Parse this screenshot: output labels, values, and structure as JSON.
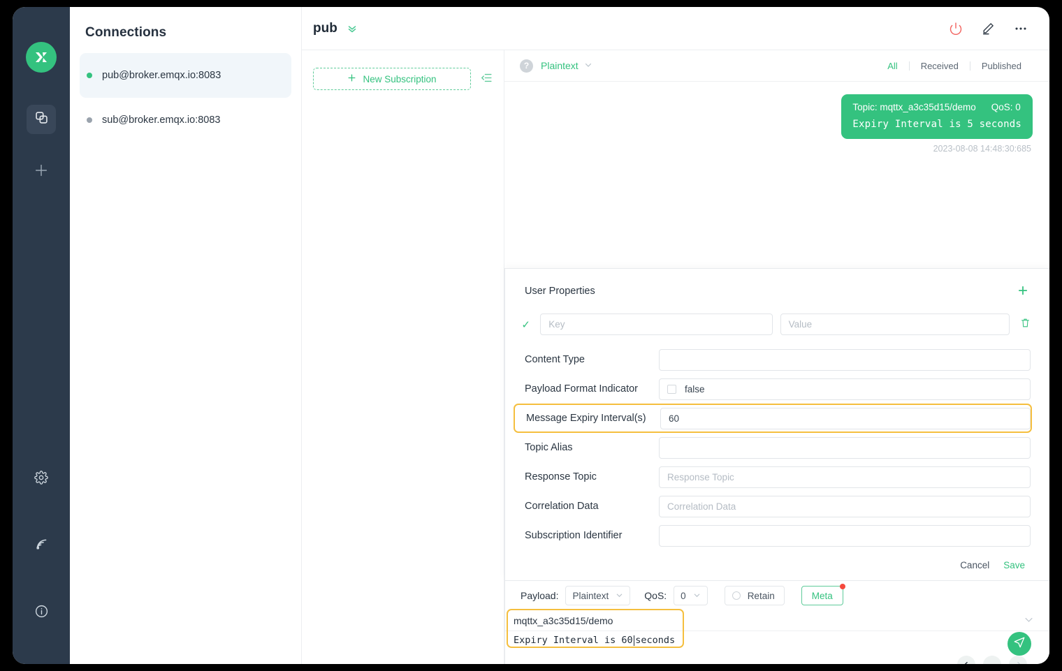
{
  "sidebar_rail": {
    "logo_icon": "mqttx-logo-icon",
    "items": [
      {
        "icon": "connections-icon",
        "name": "connections",
        "active": true
      },
      {
        "icon": "plus-icon",
        "name": "new-connection",
        "active": false
      }
    ],
    "bottom_items": [
      {
        "icon": "gear-icon",
        "name": "settings"
      },
      {
        "icon": "broadcast-icon",
        "name": "logs"
      },
      {
        "icon": "info-icon",
        "name": "about"
      }
    ]
  },
  "connections": {
    "title": "Connections",
    "items": [
      {
        "label": "pub@broker.emqx.io:8083",
        "status": "online",
        "selected": true
      },
      {
        "label": "sub@broker.emqx.io:8083",
        "status": "offline",
        "selected": false
      }
    ]
  },
  "topbar": {
    "tab_title": "pub",
    "chevron_icon": "double-chevron-down-icon",
    "actions": [
      {
        "icon": "power-icon",
        "name": "disconnect"
      },
      {
        "icon": "edit-icon",
        "name": "edit-connection"
      },
      {
        "icon": "more-icon",
        "name": "more-options"
      }
    ]
  },
  "subscriptions": {
    "new_subscription_label": "New Subscription",
    "plus_icon": "plus-icon",
    "collapse_icon": "collapse-list-icon"
  },
  "messages_toolbar": {
    "help_icon": "help-circle-icon",
    "format_value": "Plaintext",
    "format_chevron": "chevron-down-icon",
    "filters": [
      {
        "label": "All",
        "active": true
      },
      {
        "label": "Received",
        "active": false
      },
      {
        "label": "Published",
        "active": false
      }
    ]
  },
  "messages": [
    {
      "topic_label": "Topic: mqttx_a3c35d15/demo",
      "qos_label": "QoS: 0",
      "payload": "Expiry Interval is 5 seconds",
      "time": "2023-08-08 14:48:30:685",
      "direction": "published"
    }
  ],
  "meta_panel": {
    "title": "User Properties",
    "add_icon": "plus-icon",
    "user_property_row": {
      "check_icon": "check-icon",
      "key_placeholder": "Key",
      "key_value": "",
      "value_placeholder": "Value",
      "value_value": "",
      "delete_icon": "trash-icon"
    },
    "fields": [
      {
        "label": "Content Type",
        "value": "",
        "placeholder": "",
        "type": "text",
        "highlight": false
      },
      {
        "label": "Payload Format Indicator",
        "value": "false",
        "placeholder": "",
        "type": "checkbox",
        "highlight": false
      },
      {
        "label": "Message Expiry Interval(s)",
        "value": "60",
        "placeholder": "",
        "type": "text",
        "highlight": true
      },
      {
        "label": "Topic Alias",
        "value": "",
        "placeholder": "",
        "type": "text",
        "highlight": false
      },
      {
        "label": "Response Topic",
        "value": "",
        "placeholder": "Response Topic",
        "type": "text",
        "highlight": false
      },
      {
        "label": "Correlation Data",
        "value": "",
        "placeholder": "Correlation Data",
        "type": "text",
        "highlight": false
      },
      {
        "label": "Subscription Identifier",
        "value": "",
        "placeholder": "",
        "type": "text",
        "highlight": false
      }
    ],
    "cancel_label": "Cancel",
    "save_label": "Save"
  },
  "publish_bar": {
    "payload_label": "Payload:",
    "payload_value": "Plaintext",
    "qos_label": "QoS:",
    "qos_value": "0",
    "retain_label": "Retain",
    "retain_checked": false,
    "meta_label": "Meta",
    "meta_has_badge": true,
    "topic_value": "mqttx_a3c35d15/demo",
    "message_before_caret": "Expiry Interval is 60",
    "message_after_caret": " seconds",
    "expand_icon": "chevron-down-icon",
    "nav_prev_icon": "arrow-left-icon",
    "nav_mid_icon": "dash-icon",
    "nav_next_icon": "arrow-right-icon",
    "send_icon": "send-icon"
  },
  "colors": {
    "accent_green": "#34c27f",
    "highlight_amber": "#f5bf3f",
    "rail_dark": "#2c3a4b",
    "power_red": "#f2635f",
    "badge_red": "#f5493d"
  }
}
